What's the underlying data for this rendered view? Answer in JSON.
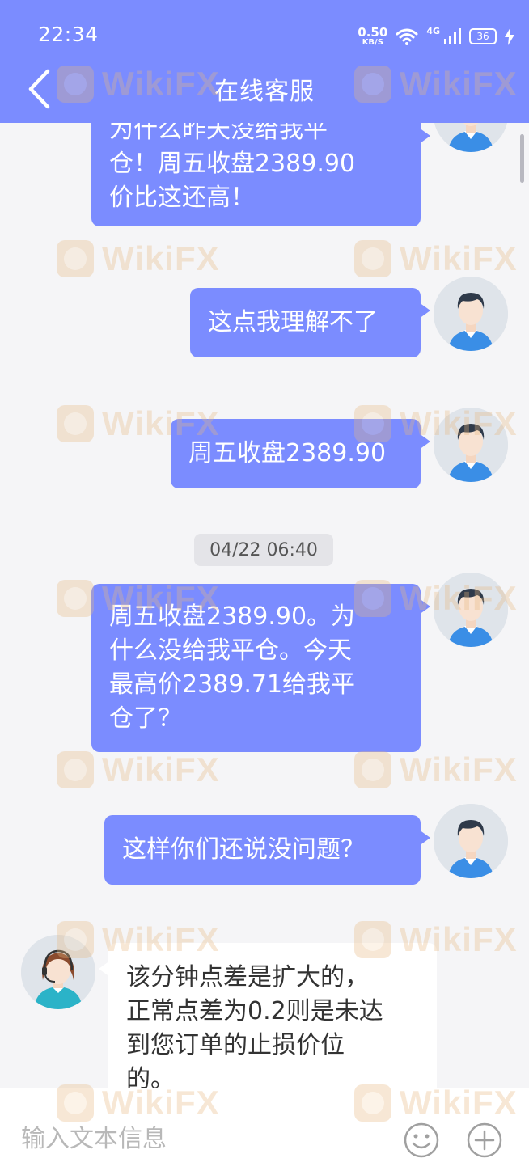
{
  "status_bar": {
    "time": "22:34",
    "net_speed": "0.50",
    "net_unit": "KB/S",
    "network": "4G",
    "battery": "36"
  },
  "nav": {
    "title": "在线客服"
  },
  "messages": [
    {
      "sender": "user",
      "lines": [
        "为什么昨天没给我平",
        "仓！周五收盘2389.90",
        "价比这还高！"
      ]
    },
    {
      "sender": "user",
      "lines": [
        "这点我理解不了"
      ]
    },
    {
      "sender": "user",
      "lines": [
        "周五收盘2389.90"
      ]
    },
    {
      "sender": "timestamp",
      "text": "04/22 06:40"
    },
    {
      "sender": "user",
      "lines": [
        "周五收盘2389.90。为",
        "什么没给我平仓。今天",
        "最高价2389.71给我平",
        "仓了？"
      ]
    },
    {
      "sender": "user",
      "lines": [
        "这样你们还说没问题？"
      ]
    },
    {
      "sender": "agent",
      "lines": [
        "该分钟点差是扩大的，",
        "正常点差为0.2则是未达",
        "到您订单的止损价位",
        "的。"
      ]
    }
  ],
  "input": {
    "placeholder": "输入文本信息"
  },
  "icons": {
    "back": "chevron-left-icon",
    "emoji": "smiley-icon",
    "plus": "plus-circle-icon"
  },
  "watermark": {
    "text": "WikiFX"
  },
  "colors": {
    "accent": "#7b8cff",
    "background": "#f5f5f7",
    "agent_bubble": "#ffffff",
    "watermark": "#e8b880"
  }
}
